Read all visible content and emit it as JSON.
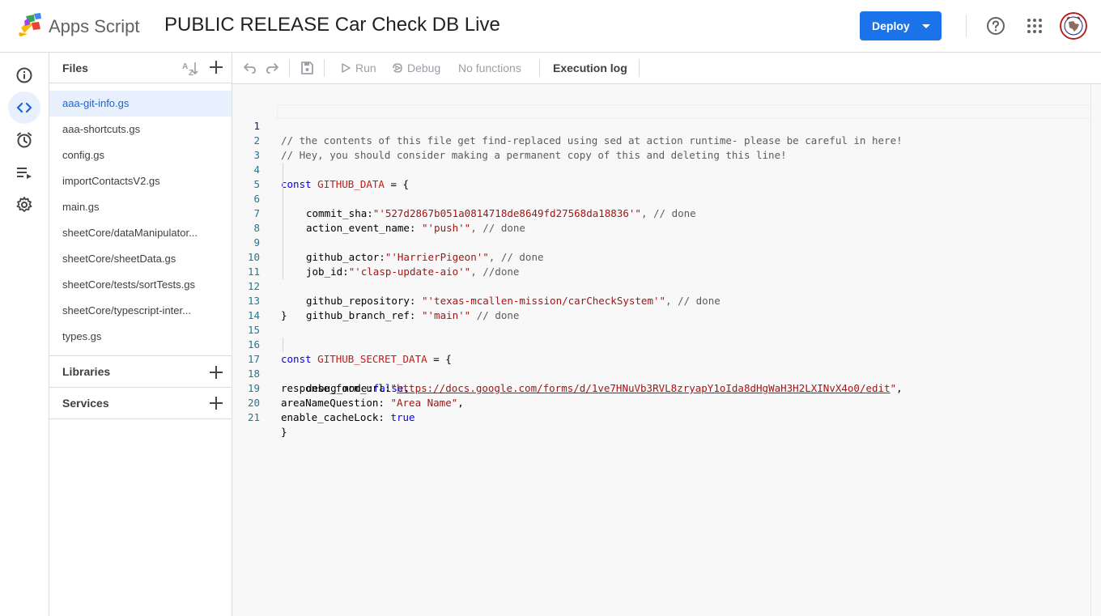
{
  "header": {
    "app_name": "Apps Script",
    "project_title": "PUBLIC RELEASE Car Check DB Live",
    "deploy_label": "Deploy"
  },
  "rail": {
    "items": [
      {
        "name": "overview",
        "icon": "info-icon"
      },
      {
        "name": "editor",
        "icon": "code-icon",
        "active": true
      },
      {
        "name": "triggers",
        "icon": "alarm-clock-icon"
      },
      {
        "name": "executions",
        "icon": "executions-list-icon"
      },
      {
        "name": "settings",
        "icon": "gear-icon"
      }
    ]
  },
  "files": {
    "header": "Files",
    "items": [
      "aaa-git-info.gs",
      "aaa-shortcuts.gs",
      "config.gs",
      "importContactsV2.gs",
      "main.gs",
      "sheetCore/dataManipulator...",
      "sheetCore/sheetData.gs",
      "sheetCore/tests/sortTests.gs",
      "sheetCore/typescript-inter...",
      "types.gs"
    ],
    "active_index": 0
  },
  "libraries": {
    "label": "Libraries"
  },
  "services": {
    "label": "Services"
  },
  "toolbar": {
    "run": "Run",
    "debug": "Debug",
    "function_select": "No functions",
    "execution_log": "Execution log"
  },
  "editor": {
    "lines": [
      "1",
      "2",
      "3",
      "4",
      "5",
      "6",
      "7",
      "8",
      "9",
      "10",
      "11",
      "12",
      "13",
      "14",
      "15",
      "16",
      "17",
      "18",
      "19",
      "20",
      "21"
    ],
    "code": {
      "l1": "// the contents of this file get find-replaced using sed at action runtime- please be careful in here!",
      "l2": "// Hey, you should consider making a permanent copy of this and deleting this line!",
      "l4_kw": "const",
      "l4_var": "GITHUB_DATA",
      "l4_rest": " = {",
      "l5_key": "commit_sha:",
      "l5_str": "\"'527d2867b051a0814718de8649fd27568da18836'\"",
      "l5_rest": ", // done",
      "l6_key": "action_event_name: ",
      "l6_str": "\"'push'\"",
      "l6_rest": ", // done",
      "l8_key": "github_actor:",
      "l8_str": "\"'HarrierPigeon'\"",
      "l8_rest": ", // done",
      "l9_key": "job_id:",
      "l9_str": "\"'clasp-update-aio'\"",
      "l9_rest": ", //done",
      "l11_key": "github_repository: ",
      "l11_str": "\"'texas-mcallen-mission/carCheckSystem'\"",
      "l11_rest": ", // done",
      "l12_key": "github_branch_ref: ",
      "l12_str": "\"'main'\"",
      "l12_rest": " // done",
      "l13": "}",
      "l16_kw": "const",
      "l16_var": "GITHUB_SECRET_DATA",
      "l16_rest": " = {",
      "l17_key": "debug_mode:",
      "l17_val": "false",
      "l17_rest": ",",
      "l18_key": "response_form_url:",
      "l18_q1": "\"",
      "l18_link": "https://docs.google.com/forms/d/1ve7HNuVb3RVL8zryapY1oIda8dHgWaH3H2LXINvX4o0/edit",
      "l18_q2": "\"",
      "l18_rest": ",",
      "l19_key": "areaNameQuestion: ",
      "l19_str": "\"Area Name\"",
      "l19_rest": ",",
      "l20_key": "enable_cacheLock: ",
      "l20_val": "true",
      "l21": "}"
    }
  },
  "colors": {
    "accent": "#1a73e8",
    "active_file_bg": "#e8f0fe",
    "code_string": "#a31515",
    "code_keyword": "#0000ff",
    "line_number": "#237893"
  }
}
